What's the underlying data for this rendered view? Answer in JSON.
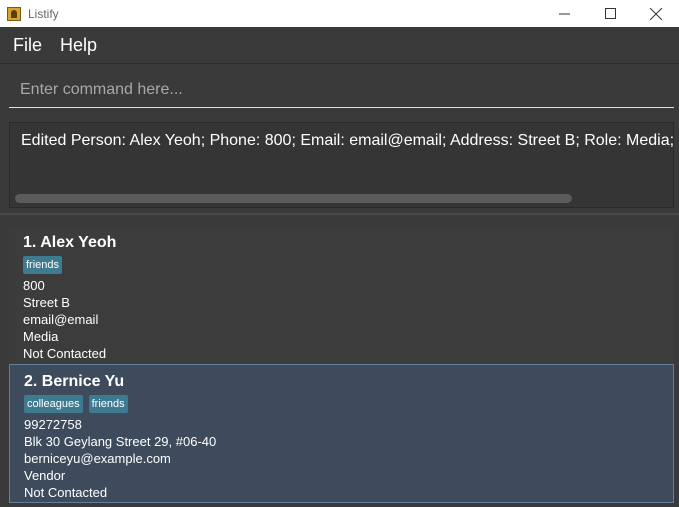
{
  "window": {
    "title": "Listify",
    "icon": "app-icon"
  },
  "menu": {
    "items": [
      "File",
      "Help"
    ]
  },
  "command": {
    "placeholder": "Enter command here...",
    "value": ""
  },
  "result": {
    "text": "Edited Person: Alex Yeoh; Phone: 800; Email: email@email; Address: Street B; Role: Media; Tags: [friends]"
  },
  "persons": [
    {
      "index_name": "1.  Alex Yeoh",
      "tags": [
        "friends"
      ],
      "phone": "800",
      "address": "Street B",
      "email": "email@email",
      "role": "Media",
      "status": "Not Contacted"
    },
    {
      "index_name": "2.  Bernice Yu",
      "tags": [
        "colleagues",
        "friends"
      ],
      "phone": "99272758",
      "address": "Blk 30 Geylang Street 29, #06-40",
      "email": "berniceyu@example.com",
      "role": "Vendor",
      "status": "Not Contacted"
    }
  ],
  "colors": {
    "background": "#3a3a3a",
    "tag": "#3e7b91",
    "selected_card": "#3d4b5c"
  }
}
